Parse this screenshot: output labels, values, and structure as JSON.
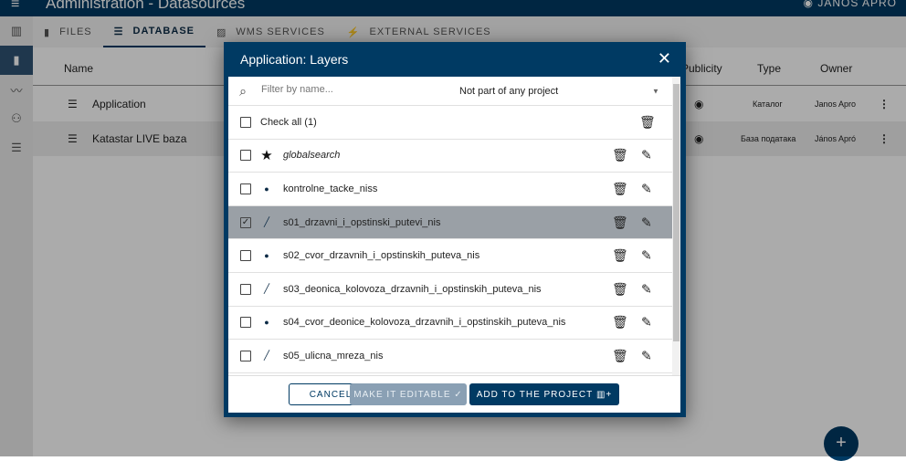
{
  "app": {
    "title": "Administration - Datasources",
    "user": "JÁNOS APRÓ",
    "menu_icon": "menu-icon",
    "user_icon": "account-circle-icon"
  },
  "sidebar": {
    "items": [
      {
        "icon": "map-icon"
      },
      {
        "icon": "file-icon",
        "active": true
      },
      {
        "icon": "chart-line-icon"
      },
      {
        "icon": "users-icon"
      },
      {
        "icon": "list-icon"
      }
    ]
  },
  "tabs": [
    {
      "label": "FILES",
      "icon": "file-icon"
    },
    {
      "label": "DATABASE",
      "icon": "database-icon",
      "active": true
    },
    {
      "label": "WMS SERVICES",
      "icon": "image-icon"
    },
    {
      "label": "EXTERNAL SERVICES",
      "icon": "plug-icon"
    }
  ],
  "table": {
    "columns": {
      "name": "Name",
      "publicity": "Publicity",
      "type": "Type",
      "owner": "Owner"
    },
    "rows": [
      {
        "name": "Application",
        "type": "Каталог",
        "owner": "Janos Apro"
      },
      {
        "name": "Katastar LIVE baza",
        "type": "База података",
        "owner": "János Apró"
      }
    ]
  },
  "dialog": {
    "title": "Application: Layers",
    "filter_placeholder": "Filter by name...",
    "project_select": "Not part of any project",
    "check_all": "Check all (1)",
    "layers": [
      {
        "name": "globalsearch",
        "icon": "star-icon",
        "checked": false,
        "italic": true
      },
      {
        "name": "kontrolne_tacke_niss",
        "icon": "point-icon",
        "checked": false
      },
      {
        "name": "s01_drzavni_i_opstinski_putevi_nis",
        "icon": "line-icon",
        "checked": true
      },
      {
        "name": "s02_cvor_drzavnih_i_opstinskih_puteva_nis",
        "icon": "point-icon",
        "checked": false
      },
      {
        "name": "s03_deonica_kolovoza_drzavnih_i_opstinskih_puteva_nis",
        "icon": "line-icon",
        "checked": false
      },
      {
        "name": "s04_cvor_deonice_kolovoza_drzavnih_i_opstinskih_puteva_nis",
        "icon": "point-icon",
        "checked": false
      },
      {
        "name": "s05_ulicna_mreza_nis",
        "icon": "line-icon",
        "checked": false
      }
    ],
    "cancel": "CANCEL",
    "make_editable": "MAKE IT EDITABLE",
    "add_to_project": "ADD TO THE PROJECT"
  },
  "colors": {
    "primary": "#003a63",
    "selected_row": "#9aa0a6",
    "disabled_button": "#8aa0b4"
  }
}
